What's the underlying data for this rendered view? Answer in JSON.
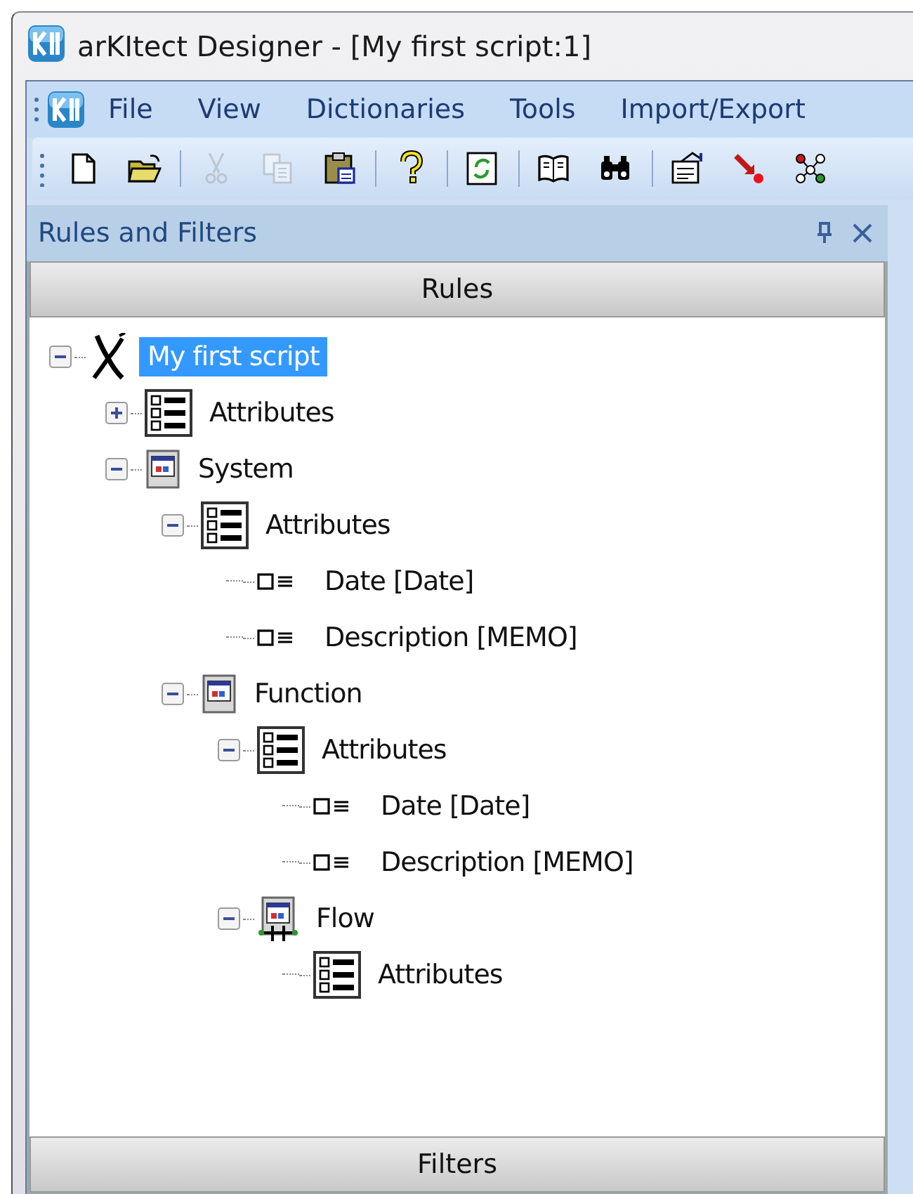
{
  "window": {
    "title": "arKItect Designer - [My first script:1]"
  },
  "menu": [
    "File",
    "View",
    "Dictionaries",
    "Tools",
    "Import/Export"
  ],
  "toolbar": [
    {
      "kind": "new",
      "disabled": false
    },
    {
      "kind": "open",
      "disabled": false
    },
    {
      "kind": "sep"
    },
    {
      "kind": "cut",
      "disabled": true
    },
    {
      "kind": "copy",
      "disabled": true
    },
    {
      "kind": "paste",
      "disabled": false
    },
    {
      "kind": "sep"
    },
    {
      "kind": "help",
      "disabled": false
    },
    {
      "kind": "sep"
    },
    {
      "kind": "refresh",
      "disabled": false
    },
    {
      "kind": "sep"
    },
    {
      "kind": "book",
      "disabled": false
    },
    {
      "kind": "find",
      "disabled": false
    },
    {
      "kind": "sep"
    },
    {
      "kind": "props",
      "disabled": false
    },
    {
      "kind": "arrow",
      "disabled": false
    },
    {
      "kind": "nodes",
      "disabled": false
    }
  ],
  "panel": {
    "title": "Rules and Filters",
    "sections": [
      "Rules",
      "Filters"
    ]
  },
  "tree": [
    {
      "label": "My first script",
      "kind": "script",
      "selected": true,
      "expanded": true,
      "children": [
        {
          "label": "Attributes",
          "kind": "list",
          "selected": false,
          "expanded": false
        },
        {
          "label": "System",
          "kind": "window",
          "selected": false,
          "expanded": true,
          "children": [
            {
              "label": "Attributes",
              "kind": "list",
              "selected": false,
              "expanded": true,
              "children": [
                {
                  "label": "Date [Date]",
                  "kind": "field",
                  "selected": false
                },
                {
                  "label": "Description [MEMO]",
                  "kind": "field",
                  "selected": false
                }
              ]
            },
            {
              "label": "Function",
              "kind": "window",
              "selected": false,
              "expanded": true,
              "children": [
                {
                  "label": "Attributes",
                  "kind": "list",
                  "selected": false,
                  "expanded": true,
                  "children": [
                    {
                      "label": "Date [Date]",
                      "kind": "field",
                      "selected": false
                    },
                    {
                      "label": "Description [MEMO]",
                      "kind": "field",
                      "selected": false
                    }
                  ]
                },
                {
                  "label": "Flow",
                  "kind": "flow",
                  "selected": false,
                  "expanded": true,
                  "children": [
                    {
                      "label": "Attributes",
                      "kind": "list",
                      "selected": false
                    }
                  ]
                }
              ]
            }
          ]
        }
      ]
    }
  ]
}
